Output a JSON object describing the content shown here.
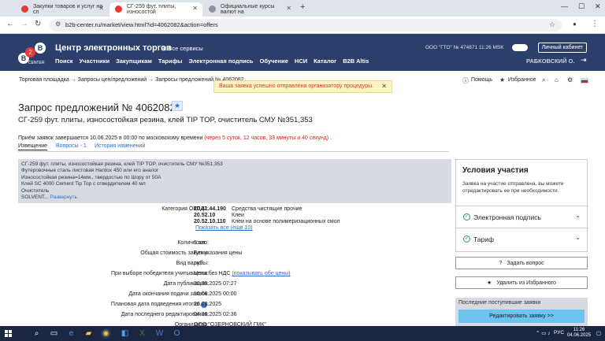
{
  "browser": {
    "tabs": [
      {
        "title": "Закупки товаров и услуг на сп",
        "active": false
      },
      {
        "title": "СГ-259 фут. плиты, износостой",
        "active": true
      },
      {
        "title": "Официальные курсы валют на",
        "active": false
      }
    ],
    "url": "b2b-center.ru/market/view.html?id=4062082&action=offers"
  },
  "header": {
    "logo_letter": "B",
    "logo_badge": "2",
    "logo_caption": "CENTER",
    "brand": "Центр электронных торгов",
    "all_services": "Все сервисы",
    "nav": [
      "Поиск",
      "Участники",
      "Закупщикам",
      "Тарифы",
      "Электронная подпись",
      "Обучение",
      "НСИ",
      "Каталог",
      "B2B Altis"
    ],
    "org": "ООО \"ГТО\"  № 474871  11:26 MSK",
    "cabinet_label": "Личный кабинет",
    "user": "РАБКОВСКИЙ О."
  },
  "breadcrumb": "Торговая площадка → Запросы цен/предложений → Запросы предложений № 4062082",
  "tools": {
    "help": "Помощь",
    "favorites": "Избранное"
  },
  "notice": "Ваша заявка успешно отправлена организатору процедуры.",
  "page": {
    "title": "Запрос предложений № 4062082",
    "subtitle": "СГ-259 фут. плиты, износостойкая резина, клей TIP TOP, очиститель СМУ №351,353",
    "deadline_text": "Приём заявок завершается 10.06.2025 в 00:00 по московскому времени",
    "deadline_left": "(через 5 суток, 12 часов, 33 минуты и 40 секунд)",
    "deadline_dot": ".",
    "tabs": [
      "Извещение",
      "Вопросы - 1",
      "История изменений"
    ]
  },
  "description": {
    "lines": [
      "СГ-259 фут. плиты, износостойкая резина, клей TIP TOP, очиститель СМУ №351,353",
      "Футеровочные сталь листовая Hardox 450 или его аналог",
      "Износостойкая резина=14мм., твердостью по Шору от 50А",
      "Клей SC 4000 Cement Tip Top с отвердителем 40 мл",
      "Очиститель",
      "SOLVENT..."
    ],
    "expand": "Развернуть"
  },
  "details": {
    "okpd_label": "Категория ОКПД2:",
    "okpd": [
      {
        "code": "20.41.44.190",
        "name": "Средства чистящие прочие"
      },
      {
        "code": "20.52.10",
        "name": "Клеи"
      },
      {
        "code": "20.52.10.110",
        "name": "Клеи на основе полимеризационных смол"
      }
    ],
    "okpd_more": "Показать все (ещё 10)",
    "quantity_label": "Количество:",
    "quantity": "1 шт.",
    "total_label": "Общая стоимость закупки:",
    "total": "Без указания цены",
    "currency_label": "Вид валюты:",
    "currency": "руб.",
    "winner_label": "При выборе победителя учитывается:",
    "winner": "Цена без НДС",
    "winner_link": "(показывать обе цены)",
    "published_label": "Дата публикации:",
    "published": "30.05.2025 07:27",
    "end_label": "Дата окончания подачи заявок:",
    "end": "10.06.2025 00:00",
    "planned_label": "Плановая дата подведения итогов",
    "planned": "20.06.2025",
    "edited_label": "Дата последнего редактирования:",
    "edited": "04.06.2025 02:36",
    "organizer_label": "Организатор:",
    "organizer": "ООО \"ОЗЕРНОВСКИЙ ГМК\""
  },
  "sidebar": {
    "title": "Условия участия",
    "text": "Заявка на участие отправлена, вы можете отредактировать ее при необходимости.",
    "items": [
      "Электронная подпись",
      "Тариф"
    ],
    "ask": "Задать вопрос",
    "unfav": "Удалить из Избранного",
    "recent_title": "Последние поступившие заявки",
    "edit": "Редактировать заявку >>"
  },
  "taskbar": {
    "lang": "РУС",
    "time": "11:26",
    "date": "04.06.2025"
  },
  "colors": {
    "header": "#2c3f6b",
    "link": "#2d6fc7",
    "notice_bg": "#fff3bf",
    "edit_btn": "#6ec3ee"
  }
}
